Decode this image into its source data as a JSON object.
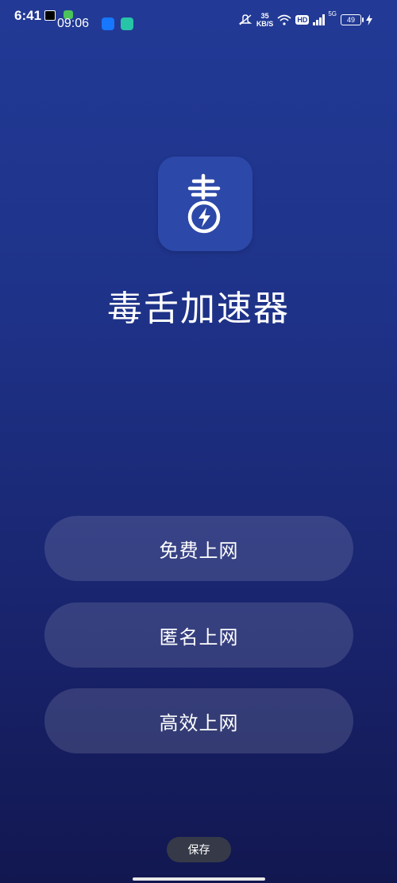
{
  "status_bar": {
    "time": "6:41",
    "secondary_time": "09:06",
    "net_speed_value": "35",
    "net_speed_unit": "KB/S",
    "hd_label": "HD",
    "signal_5g": "5G",
    "battery_level": "49"
  },
  "app": {
    "title": "毒舌加速器"
  },
  "menu": {
    "items": [
      {
        "label": "免费上网"
      },
      {
        "label": "匿名上网"
      },
      {
        "label": "高效上网"
      }
    ]
  },
  "footer": {
    "save_label": "保存"
  },
  "colors": {
    "background_top": "#223a96",
    "background_bottom": "#121750",
    "icon_bg": "#2c48a8",
    "button_bg": "rgba(255,255,255,0.13)",
    "save_pill_bg": "#363a48"
  }
}
